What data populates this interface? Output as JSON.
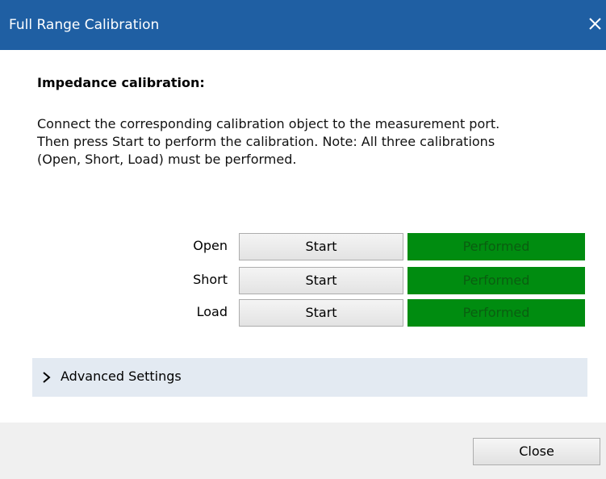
{
  "window": {
    "title": "Full Range Calibration"
  },
  "content": {
    "heading": "Impedance calibration:",
    "description_lines": [
      "Connect the corresponding calibration object to the measurement port.",
      "Then press Start to perform the calibration. Note: All three calibrations",
      "(Open, Short, Load) must be performed."
    ],
    "rows": [
      {
        "label": "Open",
        "button": "Start",
        "status": "Performed"
      },
      {
        "label": "Short",
        "button": "Start",
        "status": "Performed"
      },
      {
        "label": "Load",
        "button": "Start",
        "status": "Performed"
      }
    ]
  },
  "advanced": {
    "label": "Advanced Settings",
    "icon": "chevron-right-icon"
  },
  "footer": {
    "close_label": "Close"
  },
  "colors": {
    "titlebar": "#1f5fa3",
    "status_performed_bg": "#008c10",
    "advanced_bg": "#e3eaf2"
  }
}
